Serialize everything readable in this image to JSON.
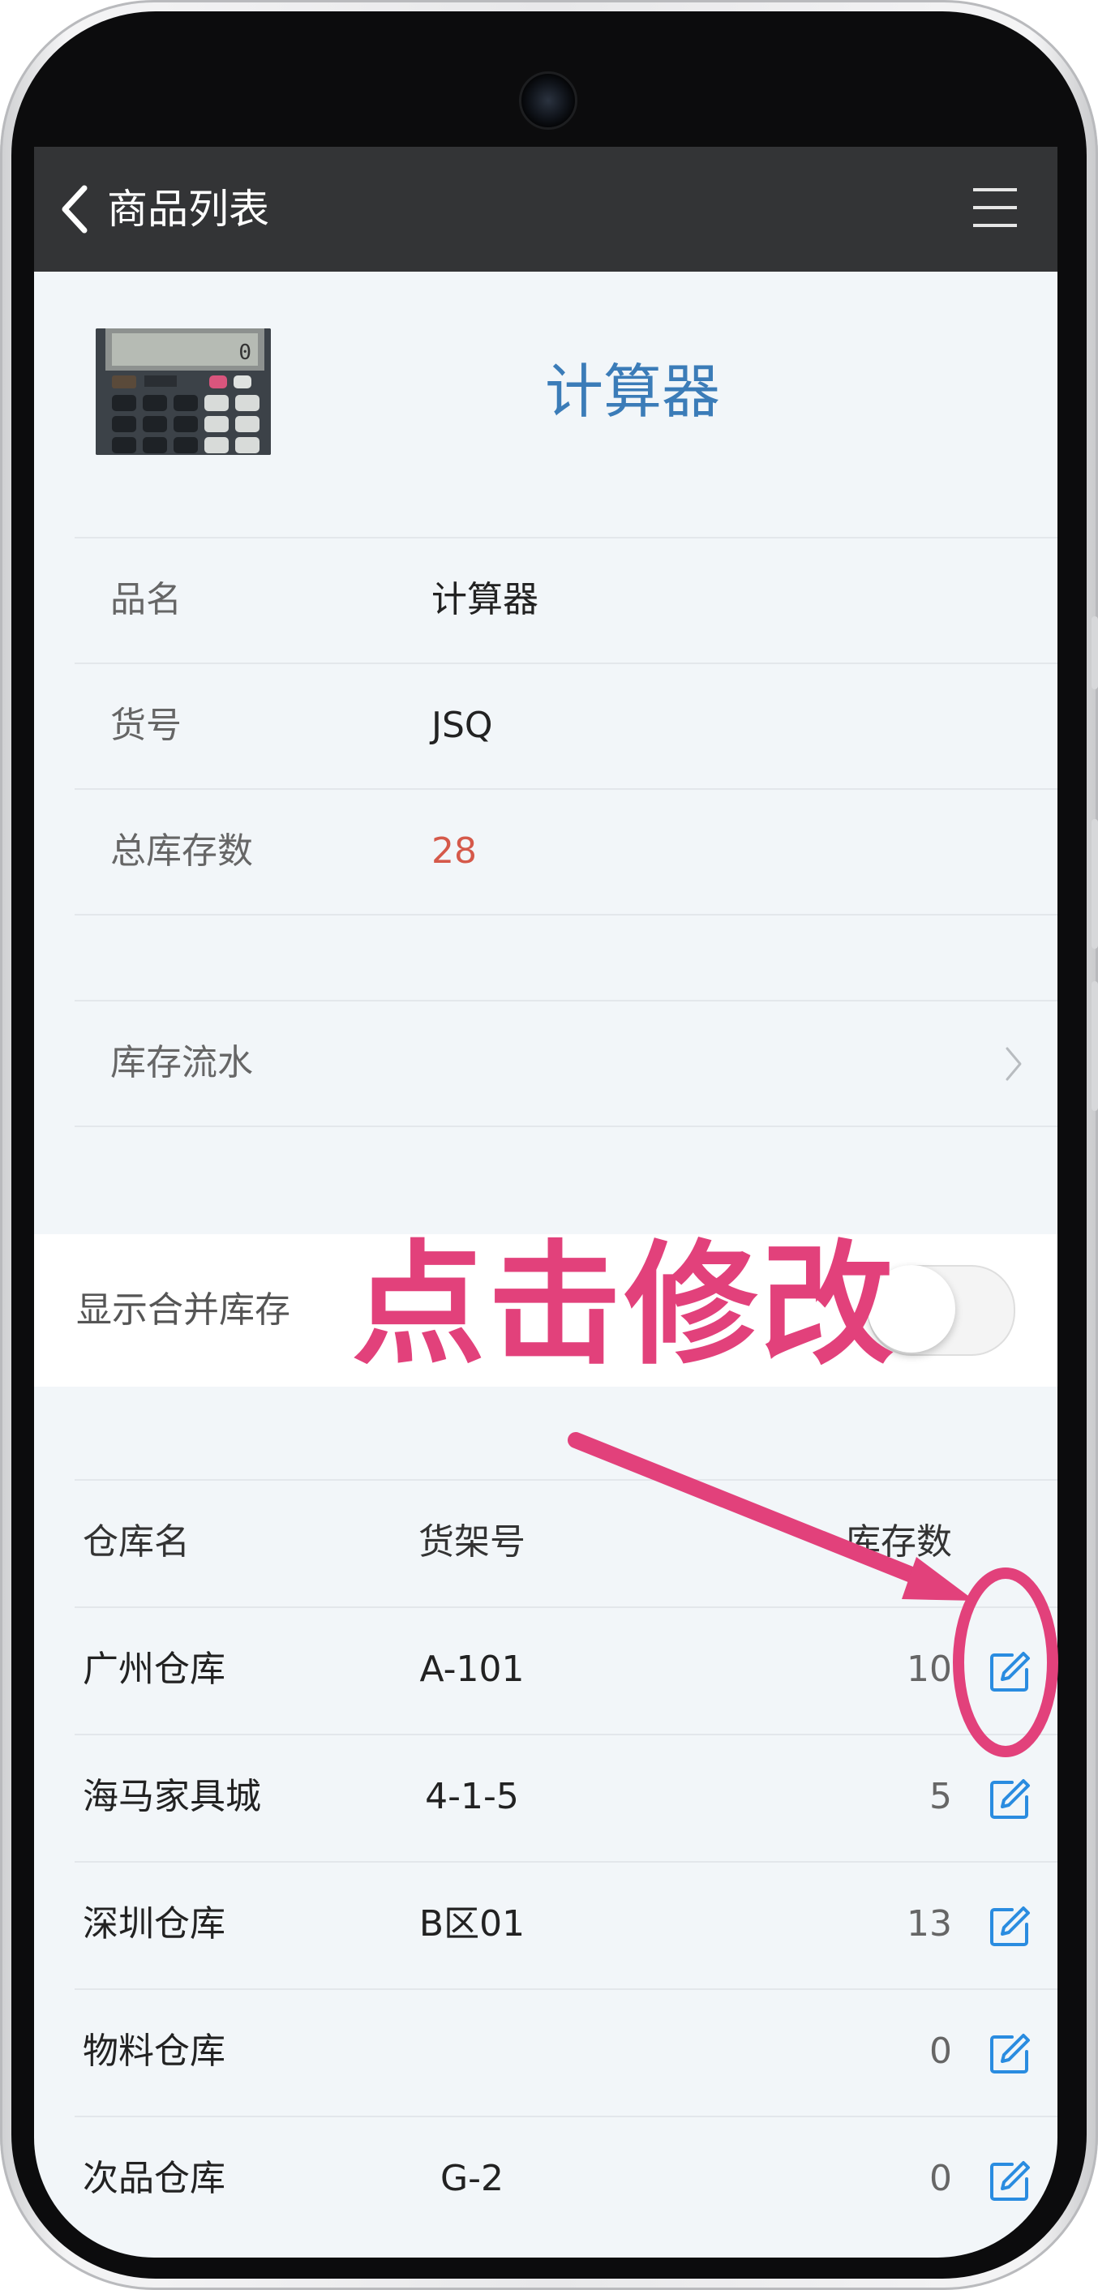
{
  "header": {
    "title": "商品列表",
    "back_icon": "chevron-left-icon",
    "menu_icon": "hamburger-menu-icon"
  },
  "product": {
    "image_desc": "calculator",
    "title": "计算器",
    "fields": [
      {
        "label": "品名",
        "value": "计算器"
      },
      {
        "label": "货号",
        "value": "JSQ"
      },
      {
        "label": "总库存数",
        "value": "28"
      }
    ]
  },
  "stock_flow": {
    "label": "库存流水"
  },
  "merge_toggle": {
    "label": "显示合并库存",
    "on": false
  },
  "table": {
    "headers": {
      "warehouse": "仓库名",
      "shelf": "货架号",
      "stock": "库存数"
    },
    "rows": [
      {
        "warehouse": "广州仓库",
        "shelf": "A-101",
        "stock": "10"
      },
      {
        "warehouse": "海马家具城",
        "shelf": "4-1-5",
        "stock": "5"
      },
      {
        "warehouse": "深圳仓库",
        "shelf": "B区01",
        "stock": "13"
      },
      {
        "warehouse": "物料仓库",
        "shelf": "",
        "stock": "0"
      },
      {
        "warehouse": "次品仓库",
        "shelf": "G-2",
        "stock": "0"
      }
    ]
  },
  "annotation": {
    "text": "点击修改",
    "color": "#e2417b"
  },
  "colors": {
    "header_bg": "#333436",
    "title_blue": "#3b7cb8",
    "total_red": "#d5594a",
    "edit_blue": "#2a8ce0"
  }
}
